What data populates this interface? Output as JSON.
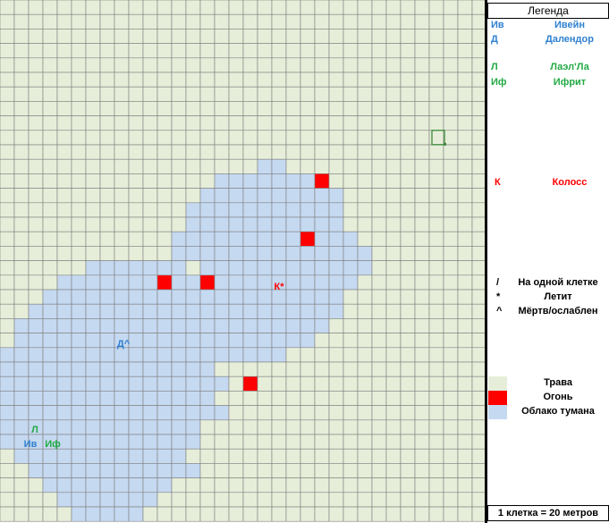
{
  "map": {
    "colors": {
      "grass": "#e6eed9",
      "fog": "#c5d9f1",
      "fire": "#ff0000",
      "grid": "#7f7f7f",
      "selection": "#3a8a3a"
    },
    "tokens": [
      {
        "label": "К*",
        "color": "#ff0000"
      },
      {
        "label": "Д^",
        "color": "#2f80d0"
      },
      {
        "label": "Л",
        "color": "#22aa44"
      },
      {
        "label": "Ив",
        "color": "#2f80d0"
      },
      {
        "label": "Иф",
        "color": "#22aa44"
      }
    ]
  },
  "legend": {
    "title": "Легенда",
    "characters": [
      {
        "abbr": "Ив",
        "name": "Ивейн",
        "color": "#2f80d0"
      },
      {
        "abbr": "Д",
        "name": "Далендор",
        "color": "#2f80d0"
      },
      {
        "abbr": "Л",
        "name": "Лаэл'Ла",
        "color": "#22aa44"
      },
      {
        "abbr": "Иф",
        "name": "Ифрит",
        "color": "#22aa44"
      },
      {
        "abbr": "К",
        "name": "Колосс",
        "color": "#ff0000"
      }
    ],
    "symbols": [
      {
        "glyph": "/",
        "text": "На одной клетке"
      },
      {
        "glyph": "*",
        "text": "Летит"
      },
      {
        "glyph": "^",
        "text": "Мёртв/ослаблен"
      }
    ],
    "terrain": [
      {
        "color": "#e6eed9",
        "text": "Трава"
      },
      {
        "color": "#ff0000",
        "text": "Огонь"
      },
      {
        "color": "#c5d9f1",
        "text": "Облако тумана"
      }
    ],
    "scale": "1 клетка = 20 метров"
  }
}
